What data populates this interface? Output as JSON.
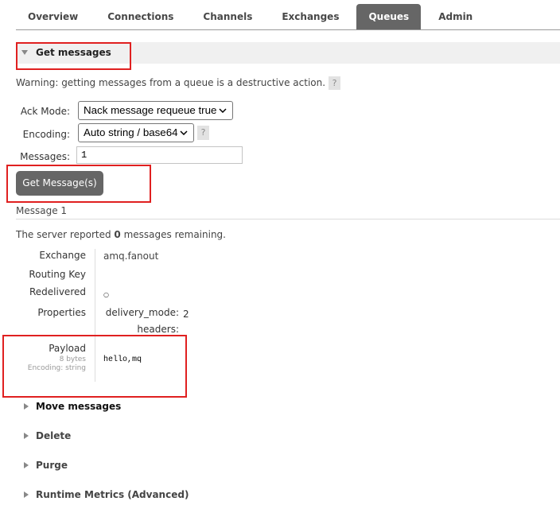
{
  "nav": {
    "tabs": [
      {
        "label": "Overview",
        "active": false
      },
      {
        "label": "Connections",
        "active": false
      },
      {
        "label": "Channels",
        "active": false
      },
      {
        "label": "Exchanges",
        "active": false
      },
      {
        "label": "Queues",
        "active": true
      },
      {
        "label": "Admin",
        "active": false
      }
    ]
  },
  "get_messages": {
    "title": "Get messages",
    "expanded": true,
    "warning": "Warning: getting messages from a queue is a destructive action.",
    "help_label": "?",
    "form": {
      "ack_mode_label": "Ack Mode:",
      "ack_mode_value": "Nack message requeue true",
      "encoding_label": "Encoding:",
      "encoding_value": "Auto string / base64",
      "encoding_help": "?",
      "messages_label": "Messages:",
      "messages_value": "1"
    },
    "submit_label": "Get Message(s)"
  },
  "result": {
    "message_heading": "Message 1",
    "server_report": {
      "prefix": "The server reported ",
      "count": "0",
      "suffix": " messages remaining."
    },
    "details": {
      "exchange_label": "Exchange",
      "exchange_value": "amq.fanout",
      "routing_key_label": "Routing Key",
      "routing_key_value": "",
      "redelivered_label": "Redelivered",
      "redelivered_value": "○",
      "properties_label": "Properties",
      "properties": [
        {
          "key": "delivery_mode:",
          "value": "2"
        },
        {
          "key": "headers:",
          "value": ""
        }
      ],
      "payload_label": "Payload",
      "payload_size": "8 bytes",
      "payload_encoding": "Encoding: string",
      "payload_value": "hello,mq"
    }
  },
  "sections": [
    {
      "label": "Move messages",
      "expanded": false
    },
    {
      "label": "Delete",
      "expanded": false
    },
    {
      "label": "Purge",
      "expanded": false
    },
    {
      "label": "Runtime Metrics (Advanced)",
      "expanded": false
    }
  ],
  "icons": {
    "expanded": "triangle-down-icon",
    "collapsed": "triangle-right-icon",
    "dropdown": "chevron-down-icon",
    "help": "help-icon"
  },
  "colors": {
    "active_tab_bg": "#666666",
    "button_bg": "#666666",
    "header_band_bg": "#f0f0f0",
    "annotation_red": "#e02020",
    "text": "#484848"
  }
}
